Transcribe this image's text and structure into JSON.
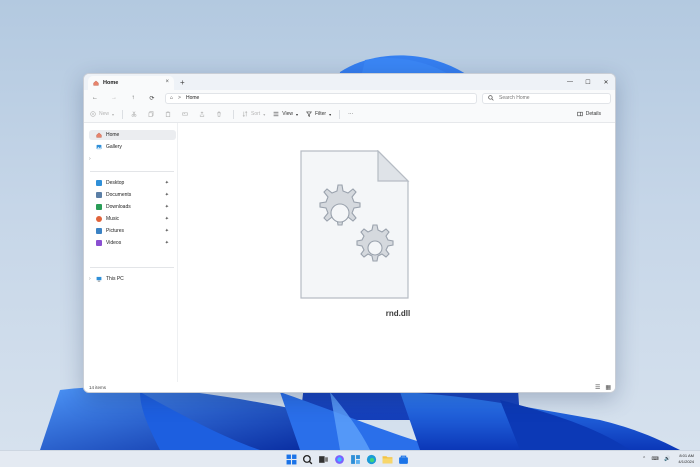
{
  "window": {
    "tab_title": "Home",
    "tab_close": "×",
    "new_tab": "+",
    "controls": {
      "minimize": "—",
      "maximize": "☐",
      "close": "✕"
    }
  },
  "addressbar": {
    "back": "←",
    "forward": "→",
    "up": "↑",
    "refresh": "⟳",
    "home_glyph": "⌂",
    "sep": ">",
    "path": "Home",
    "search_placeholder": "Search Home"
  },
  "toolbar": {
    "new_label": "New",
    "sort_label": "Sort",
    "view_label": "View",
    "filter_label": "Filter",
    "more_label": "···",
    "details_label": "Details"
  },
  "sidebar": {
    "home": "Home",
    "gallery": "Gallery",
    "quick_access": [
      {
        "label": "Desktop",
        "color": "#2f8fd8"
      },
      {
        "label": "Documents",
        "color": "#5b7fa6"
      },
      {
        "label": "Downloads",
        "color": "#2a9d57"
      },
      {
        "label": "Music",
        "color": "#e0633a"
      },
      {
        "label": "Pictures",
        "color": "#3b82c4"
      },
      {
        "label": "Videos",
        "color": "#8a4fd1"
      }
    ],
    "pin_glyph": "📌",
    "this_pc": "This PC",
    "expand_glyph": "›"
  },
  "content": {
    "file_name": "rnd.dll"
  },
  "statusbar": {
    "item_count": "14 items",
    "view_list": "☰",
    "view_grid": "▦"
  },
  "taskbar": {
    "sys_icons": "⌃ ⌨ 🔊",
    "time": "8:01 AM",
    "date": "4/1/2024"
  },
  "colors": {
    "accent": "#0067c0",
    "wallpaper_blue": "#1a5ce6"
  }
}
